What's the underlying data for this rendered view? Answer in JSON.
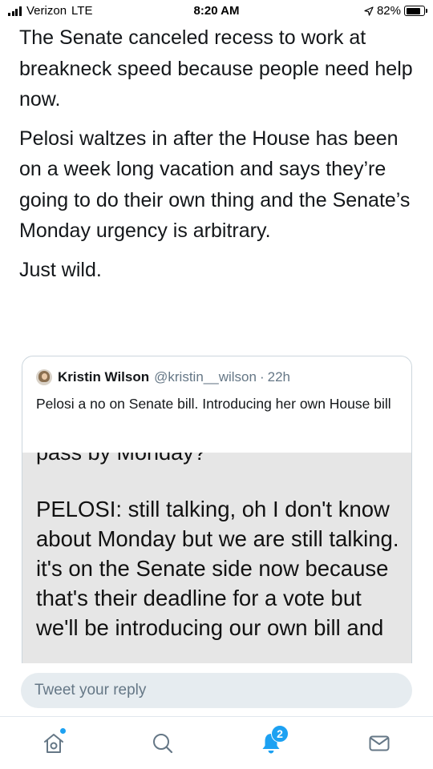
{
  "status_bar": {
    "carrier": "Verizon",
    "network": "LTE",
    "time": "8:20 AM",
    "battery_percent": "82%",
    "battery_level": 0.82
  },
  "tweet": {
    "paragraphs": [
      "The Senate canceled recess to work at breakneck speed because people need help now.",
      "Pelosi waltzes in after the House has been on a week long vacation and says they’re going to do their own thing and the Senate’s Monday urgency is arbitrary.",
      "Just wild."
    ]
  },
  "quote": {
    "author_name": "Kristin Wilson",
    "author_handle": "@kristin__wilson",
    "separator": "·",
    "time": "22h",
    "text": "Pelosi a no on Senate bill. Introducing her own House bill",
    "image_text_cut": "pass by Monday?",
    "image_text": "PELOSI: still talking, oh I don't know about Monday but we are still talking. it's on the Senate side now because that's their deadline for a vote but we'll be introducing our own bill and"
  },
  "reply": {
    "placeholder": "Tweet your reply"
  },
  "tab_bar": {
    "items": [
      {
        "name": "home",
        "icon": "home-icon",
        "has_dot": true
      },
      {
        "name": "search",
        "icon": "search-icon"
      },
      {
        "name": "notifications",
        "icon": "bell-icon",
        "badge": "2"
      },
      {
        "name": "messages",
        "icon": "mail-icon"
      }
    ]
  },
  "colors": {
    "accent": "#1da1f2",
    "text": "#14171a",
    "secondary_text": "#657786",
    "input_bg": "#e6ecf0",
    "card_border": "#ccd6dd"
  }
}
